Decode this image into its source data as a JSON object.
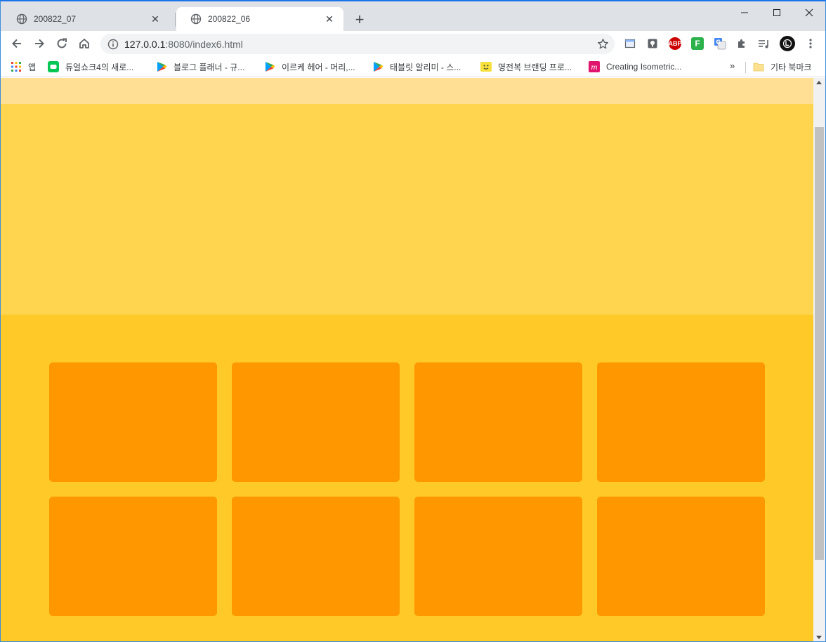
{
  "tabs": [
    {
      "title": "200822_07",
      "active": false
    },
    {
      "title": "200822_06",
      "active": true
    }
  ],
  "address": {
    "host": "127.0.0.1",
    "rest": ":8080/index6.html"
  },
  "extensions": [
    {
      "name": "tab-manager-icon"
    },
    {
      "name": "keep-icon"
    },
    {
      "name": "adblock-plus-icon",
      "label": "ABP"
    },
    {
      "name": "feedly-icon",
      "label": "F"
    },
    {
      "name": "google-translate-icon"
    },
    {
      "name": "extensions-puzzle-icon"
    },
    {
      "name": "media-playlist-icon"
    },
    {
      "name": "profile-avatar-icon"
    },
    {
      "name": "menu-kebab-icon"
    }
  ],
  "bookmarks": [
    {
      "label": "앱",
      "icon": "apps-grid-icon"
    },
    {
      "label": "듀얼쇼크4의 새로...",
      "icon": "line-icon"
    },
    {
      "label": "블로그 플래너 - 규...",
      "icon": "play-store-icon"
    },
    {
      "label": "이르케 헤어 - 머리,...",
      "icon": "play-store-icon"
    },
    {
      "label": "태블릿 알리미 - 스...",
      "icon": "play-store-icon"
    },
    {
      "label": "명전복 브랜딩 프로...",
      "icon": "smiley-icon"
    },
    {
      "label": "Creating Isometric...",
      "icon": "m-logo-icon"
    }
  ],
  "bookmarks_more": "»",
  "other_bookmarks": "기타 북마크",
  "colors": {
    "band_top": "#ffdf94",
    "hero": "#ffd54f",
    "content": "#ffca28",
    "box": "#ff9800"
  },
  "grid": {
    "rows": 2,
    "columns": 4,
    "box_count": 8
  }
}
